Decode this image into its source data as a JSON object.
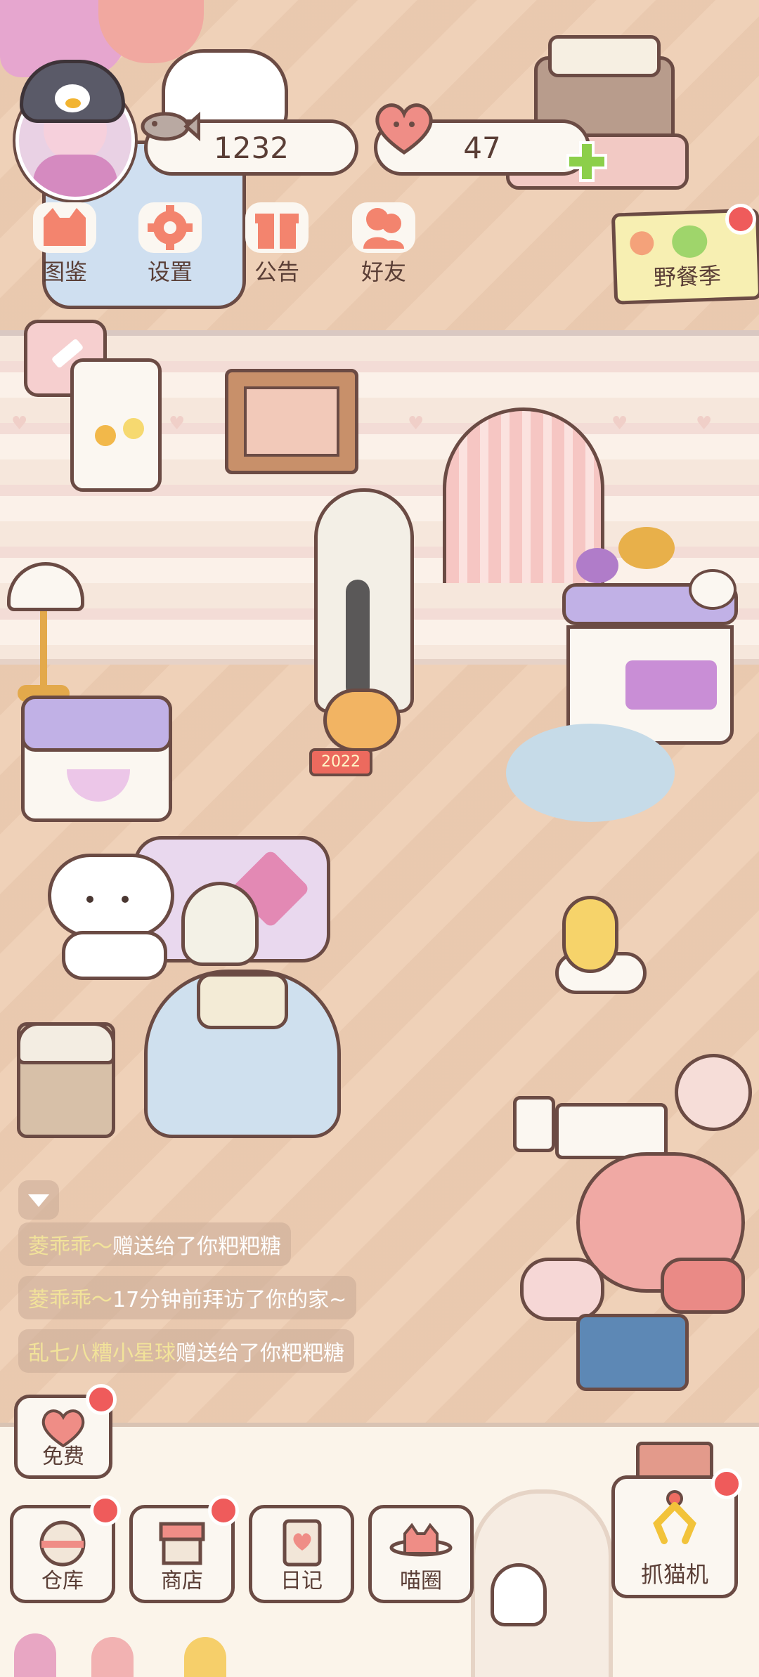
{
  "stats": {
    "coins": "1232",
    "hearts": "47"
  },
  "top_menu": [
    {
      "label": "图鉴",
      "icon": "cat-face-icon"
    },
    {
      "label": "设置",
      "icon": "gear-icon"
    },
    {
      "label": "公告",
      "icon": "gift-icon"
    },
    {
      "label": "好友",
      "icon": "friends-icon"
    }
  ],
  "event_banner": {
    "label": "野餐季"
  },
  "room_sign": {
    "text": "2022"
  },
  "feed": [
    {
      "name": "菱乖乖～",
      "text": "赠送给了你粑粑糖"
    },
    {
      "name": "菱乖乖～",
      "text": "17分钟前拜访了你的家~"
    },
    {
      "name": "乱七八糟小星球",
      "text": "赠送给了你粑粑糖"
    }
  ],
  "free_button": {
    "label": "免费"
  },
  "bottom_menu": [
    {
      "label": "仓库",
      "icon": "storage-icon"
    },
    {
      "label": "商店",
      "icon": "shop-icon"
    },
    {
      "label": "日记",
      "icon": "diary-icon"
    },
    {
      "label": "喵圈",
      "icon": "planet-cat-icon"
    }
  ],
  "claw_machine": {
    "label": "抓猫机"
  },
  "colors": {
    "accent_red": "#ef5b5b",
    "outline": "#6b4b44",
    "floor": "#eecdb2"
  }
}
